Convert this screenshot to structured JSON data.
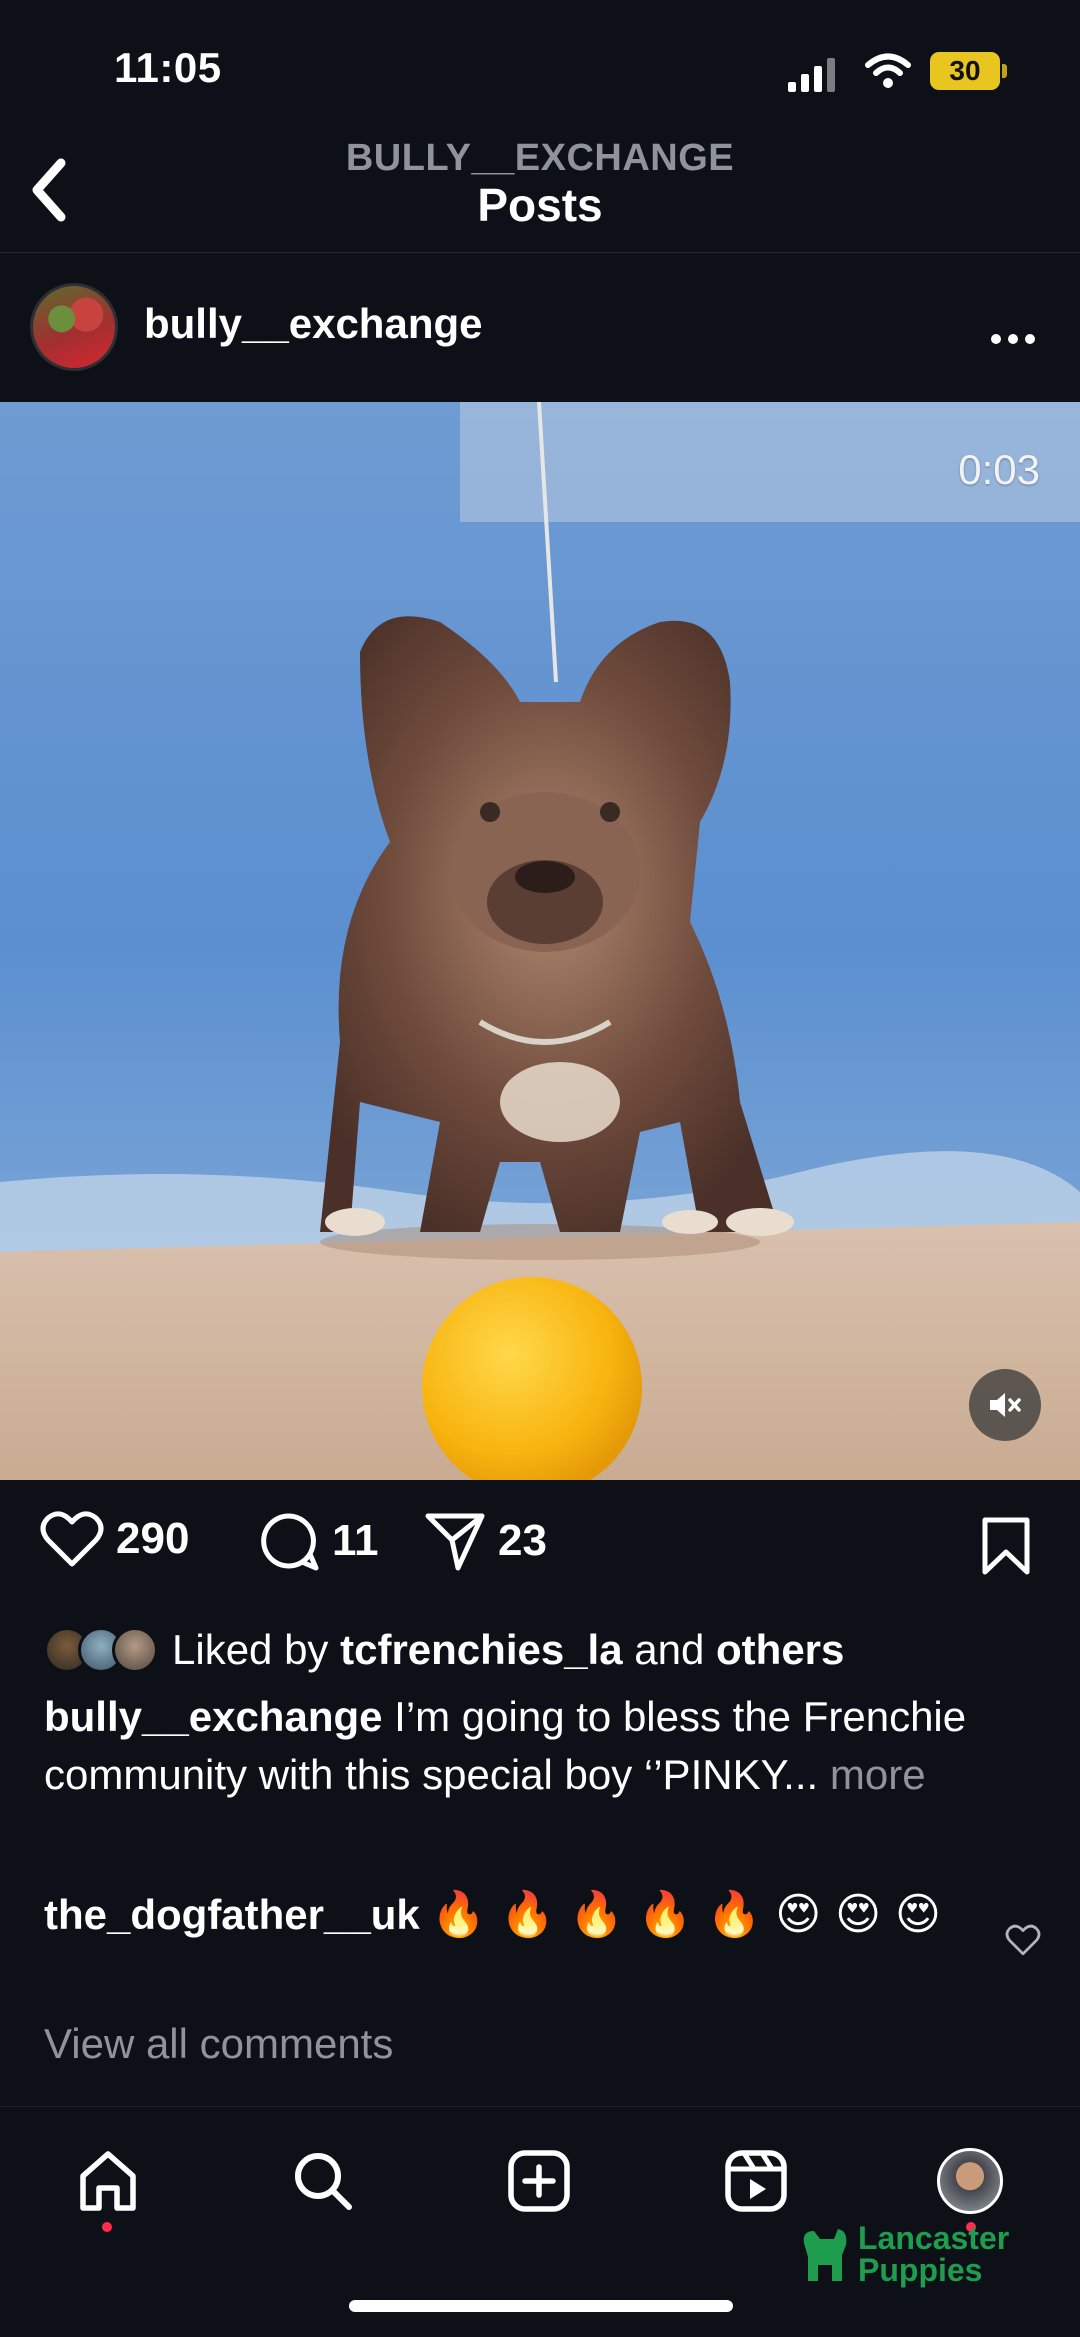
{
  "status_bar": {
    "time": "11:05",
    "battery": "30"
  },
  "header": {
    "back_icon": "chevron-left-icon",
    "super_title": "BULLY__EXCHANGE",
    "title": "Posts"
  },
  "post": {
    "username": "bully__exchange",
    "more_icon": "ellipsis-icon",
    "video": {
      "timer": "0:03",
      "mute_icon": "speaker-muted-icon"
    },
    "actions": {
      "likes": "290",
      "comments": "11",
      "shares": "23"
    },
    "liked_by": {
      "prefix": "Liked by",
      "user": "tcfrenchies_la",
      "middle": "and",
      "suffix": "others"
    },
    "caption": {
      "username": "bully__exchange",
      "text": "I’m going to bless the Frenchie community with this special boy ‘’PINKY...",
      "more": "more"
    },
    "comment": {
      "username": "the_dogfather__uk",
      "text": "🔥 🔥 🔥 🔥 🔥 😍 😍 😍"
    },
    "view_all": "View all comments"
  },
  "tab_bar": {
    "items": [
      "home",
      "search",
      "create",
      "reels",
      "profile"
    ]
  },
  "watermark": {
    "line1": "Lancaster",
    "line2": "Puppies"
  },
  "colors": {
    "background": "#0d1117",
    "muted_text": "#8e939c",
    "notification_dot": "#ff2d4b",
    "battery": "#e8c61f",
    "watermark": "#1f9d4f"
  }
}
